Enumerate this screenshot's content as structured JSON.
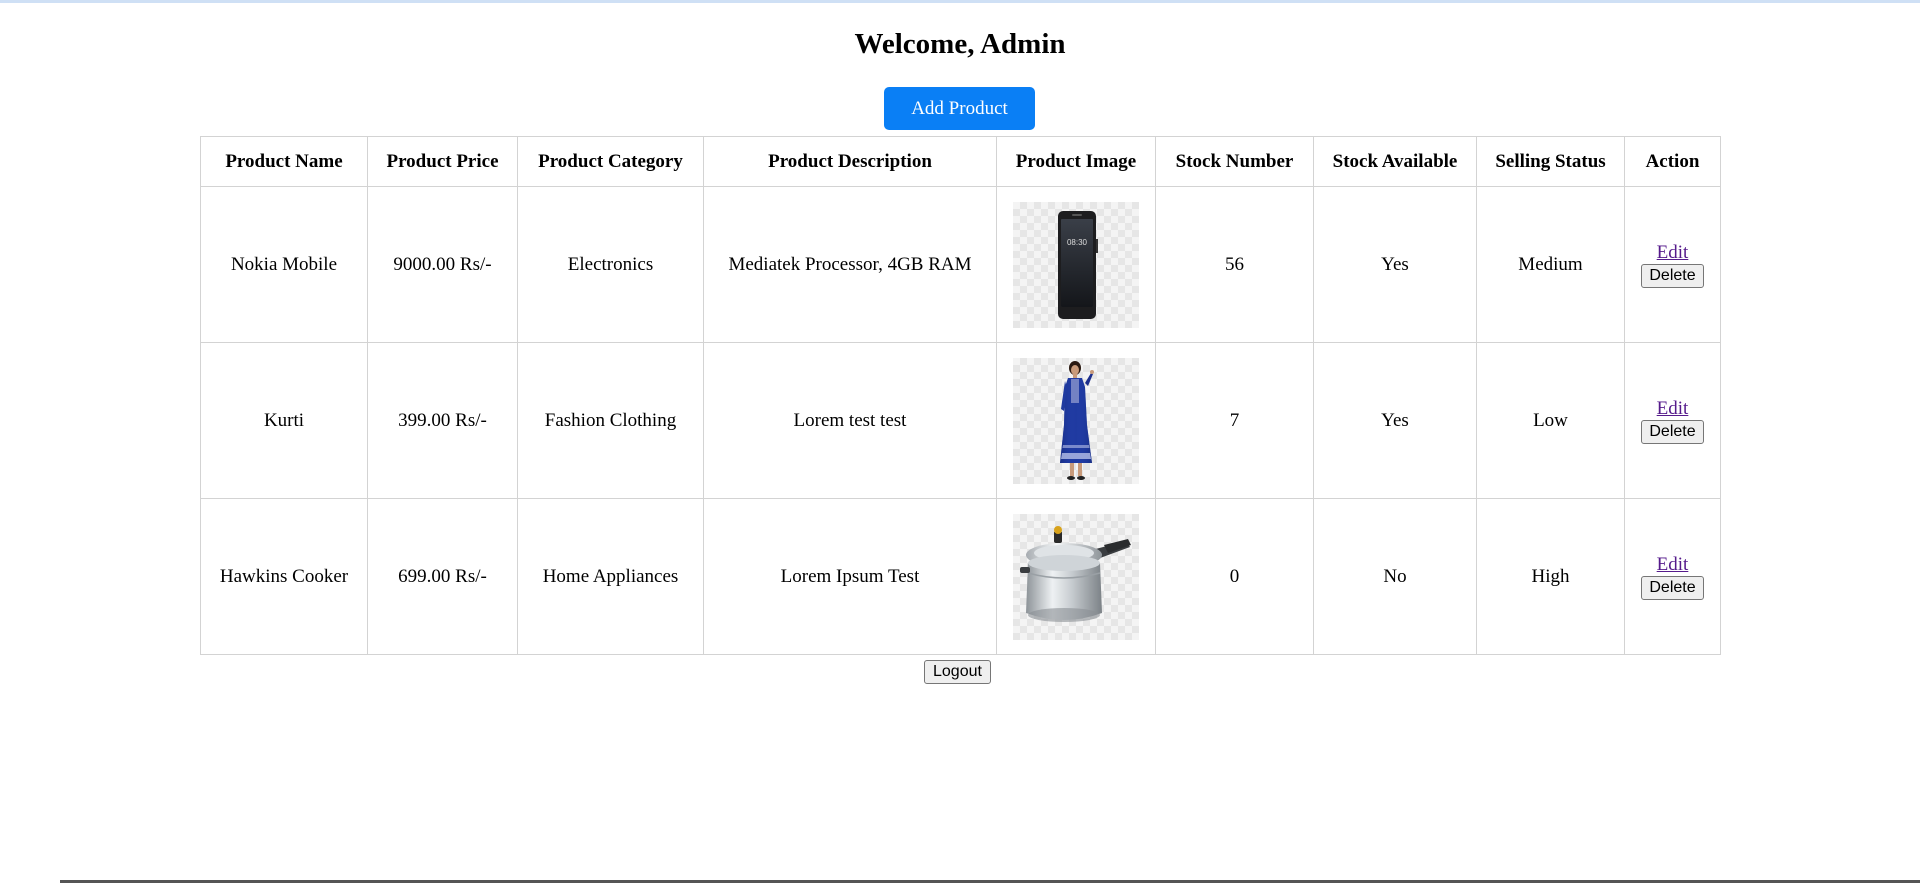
{
  "header": {
    "title": "Welcome, Admin",
    "add_button_label": "Add Product"
  },
  "table": {
    "columns": [
      "Product Name",
      "Product Price",
      "Product Category",
      "Product Description",
      "Product Image",
      "Stock Number",
      "Stock Available",
      "Selling Status",
      "Action"
    ],
    "rows": [
      {
        "name": "Nokia Mobile",
        "price": "9000.00 Rs/-",
        "category": "Electronics",
        "description": "Mediatek Processor, 4GB RAM",
        "image_icon": "smartphone-image",
        "stock_number": "56",
        "stock_available": "Yes",
        "selling_status": "Medium",
        "edit_label": "Edit",
        "delete_label": "Delete"
      },
      {
        "name": "Kurti",
        "price": "399.00 Rs/-",
        "category": "Fashion Clothing",
        "description": "Lorem test test",
        "image_icon": "kurti-dress-image",
        "stock_number": "7",
        "stock_available": "Yes",
        "selling_status": "Low",
        "edit_label": "Edit",
        "delete_label": "Delete"
      },
      {
        "name": "Hawkins Cooker",
        "price": "699.00 Rs/-",
        "category": "Home Appliances",
        "description": "Lorem Ipsum Test",
        "image_icon": "pressure-cooker-image",
        "stock_number": "0",
        "stock_available": "No",
        "selling_status": "High",
        "edit_label": "Edit",
        "delete_label": "Delete"
      }
    ]
  },
  "footer": {
    "logout_label": "Logout"
  },
  "colors": {
    "primary_button": "#0a7ff5",
    "link_visited": "#551a8b",
    "table_border": "#d3d3d3"
  }
}
